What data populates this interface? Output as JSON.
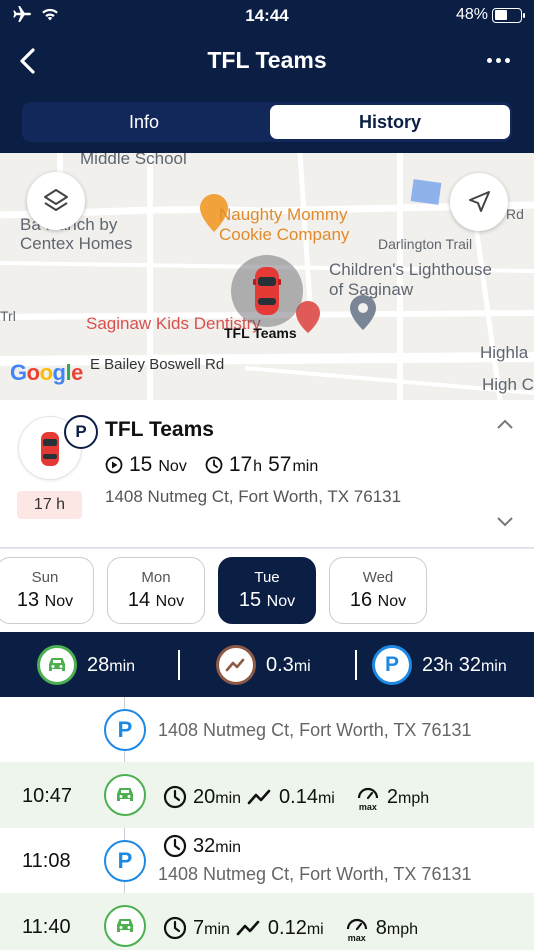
{
  "status_bar": {
    "time": "14:44",
    "battery": "48%",
    "battery_level": 0.48
  },
  "header": {
    "title": "TFL Teams"
  },
  "tabs": [
    {
      "label": "Info"
    },
    {
      "label": "History"
    }
  ],
  "map": {
    "labels": {
      "school": "Middle School",
      "ranch_1": "Ba  Ranch by",
      "ranch_2": "Centex Homes",
      "cookie_1": "Naughty Mommy",
      "cookie_2": "Cookie Company",
      "darlington": "Darlington Trail",
      "lighthouse_1": "Children's Lighthouse",
      "lighthouse_2": "of Saginaw",
      "dentistry": "Saginaw Kids Dentistry",
      "vehicle_tag": "TFL Teams",
      "bailey": "E Bailey Boswell Rd",
      "highla": "Highla",
      "high_c": "High C",
      "trl": "Trl",
      "rd": "Rd",
      "google": "Google"
    }
  },
  "vehicle": {
    "name": "TFL Teams",
    "badge": "P",
    "hours": "17 h",
    "date_num": "15",
    "date_mon": "Nov",
    "dur_h": "17",
    "dur_h_unit": "h",
    "dur_m": "57",
    "dur_m_unit": "min",
    "address": "1408 Nutmeg Ct, Fort Worth, TX 76131"
  },
  "days": [
    {
      "name": "Sun",
      "num": "13",
      "mon": "Nov"
    },
    {
      "name": "Mon",
      "num": "14",
      "mon": "Nov"
    },
    {
      "name": "Tue",
      "num": "15",
      "mon": "Nov"
    },
    {
      "name": "Wed",
      "num": "16",
      "mon": "Nov"
    }
  ],
  "summary": {
    "drive_val": "28",
    "drive_unit": "min",
    "dist_val": "0.3",
    "dist_unit": "mi",
    "park_h": "23",
    "park_h_unit": "h",
    "park_m": "32",
    "park_m_unit": "min",
    "park_label": "P"
  },
  "timeline": [
    {
      "type": "park",
      "icon": "P",
      "address": "1408 Nutmeg Ct, Fort Worth, TX 76131"
    },
    {
      "type": "drive",
      "time": "10:47",
      "dur": "20",
      "dur_unit": "min",
      "dist": "0.14",
      "dist_unit": "mi",
      "max_label": "max",
      "speed": "2",
      "speed_unit": "mph"
    },
    {
      "type": "park",
      "time": "11:08",
      "icon": "P",
      "dur": "32",
      "dur_unit": "min",
      "address": "1408 Nutmeg Ct, Fort Worth, TX 76131"
    },
    {
      "type": "drive",
      "time": "11:40",
      "dur": "7",
      "dur_unit": "min",
      "dist": "0.12",
      "dist_unit": "mi",
      "max_label": "max",
      "speed": "8",
      "speed_unit": "mph"
    }
  ],
  "colors": {
    "navy": "#0b1e44",
    "parking_blue": "#1e88e5",
    "drive_green": "#4caf50",
    "distance_brown": "#8d5a45",
    "hours_bg": "#fde7e5",
    "drive_row_bg": "#eef5ec"
  }
}
